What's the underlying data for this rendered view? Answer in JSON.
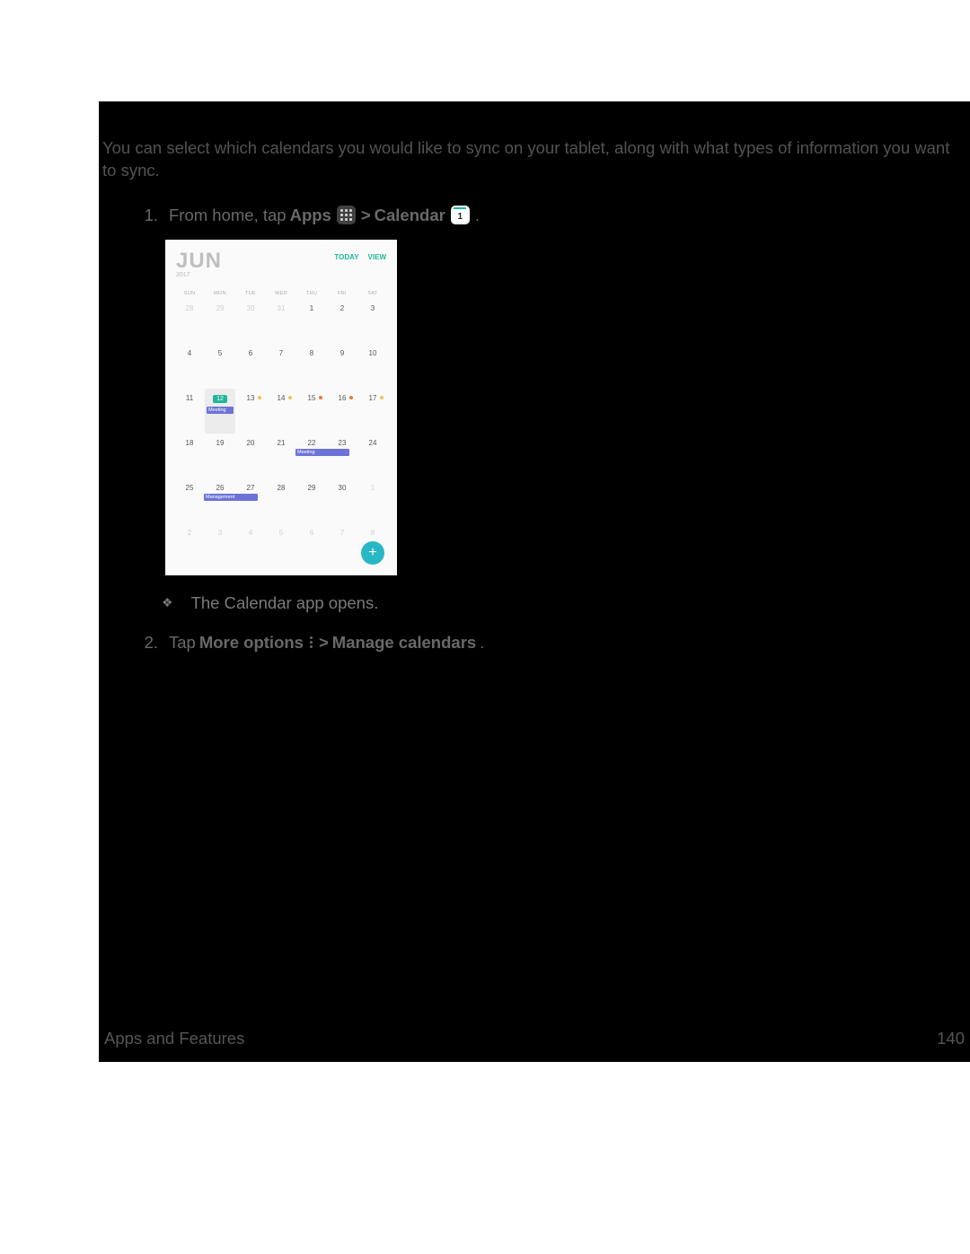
{
  "intro": "You can select which calendars you would like to sync on your tablet, along with what types of information you want to sync.",
  "steps": {
    "s1_num": "1.",
    "s1_a": "From home, tap ",
    "s1_apps": "Apps",
    "s1_gt": " > ",
    "s1_cal": "Calendar",
    "s1_end": ".",
    "s1_sub": "The Calendar app opens.",
    "s2_num": "2.",
    "s2_a": "Tap ",
    "s2_more": "More options",
    "s2_gt": " > ",
    "s2_manage": "Manage calendars",
    "s2_end": "."
  },
  "calendar": {
    "month": "JUN",
    "year": "2017",
    "today": "TODAY",
    "view": "VIEW",
    "days": [
      "SUN",
      "MON",
      "TUE",
      "WED",
      "THU",
      "FRI",
      "SAT"
    ],
    "weeks": [
      {
        "cells": [
          {
            "n": "28",
            "f": true
          },
          {
            "n": "29",
            "f": true
          },
          {
            "n": "30",
            "f": true
          },
          {
            "n": "31",
            "f": true
          },
          {
            "n": "1"
          },
          {
            "n": "2"
          },
          {
            "n": "3"
          }
        ]
      },
      {
        "cells": [
          {
            "n": "4"
          },
          {
            "n": "5"
          },
          {
            "n": "6"
          },
          {
            "n": "7"
          },
          {
            "n": "8"
          },
          {
            "n": "9"
          },
          {
            "n": "10"
          }
        ]
      },
      {
        "cells": [
          {
            "n": "11"
          },
          {
            "n": "12",
            "today": true,
            "evt": "Meeting",
            "evtTop": 20
          },
          {
            "n": "13",
            "dot": "o"
          },
          {
            "n": "14",
            "dot": "o"
          },
          {
            "n": "15",
            "dot": "b"
          },
          {
            "n": "16",
            "dot": "b"
          },
          {
            "n": "17",
            "dot": "o"
          }
        ]
      },
      {
        "cells": [
          {
            "n": "18"
          },
          {
            "n": "19"
          },
          {
            "n": "20"
          },
          {
            "n": "21"
          },
          {
            "n": "22",
            "evt": "Meeting",
            "evtTop": 17,
            "bar": true
          },
          {
            "n": "23"
          },
          {
            "n": "24"
          }
        ]
      },
      {
        "cells": [
          {
            "n": "25"
          },
          {
            "n": "26",
            "evt": "Management",
            "evtTop": 17,
            "bar": true
          },
          {
            "n": "27"
          },
          {
            "n": "28"
          },
          {
            "n": "29"
          },
          {
            "n": "30"
          },
          {
            "n": "1",
            "f": true
          }
        ]
      },
      {
        "cells": [
          {
            "n": "2",
            "f": true
          },
          {
            "n": "3",
            "f": true
          },
          {
            "n": "4",
            "f": true
          },
          {
            "n": "5",
            "f": true
          },
          {
            "n": "6",
            "f": true
          },
          {
            "n": "7",
            "f": true
          },
          {
            "n": "8",
            "f": true
          }
        ]
      }
    ],
    "day_1": "1"
  },
  "footer": {
    "section": "Apps and Features",
    "page": "140"
  }
}
